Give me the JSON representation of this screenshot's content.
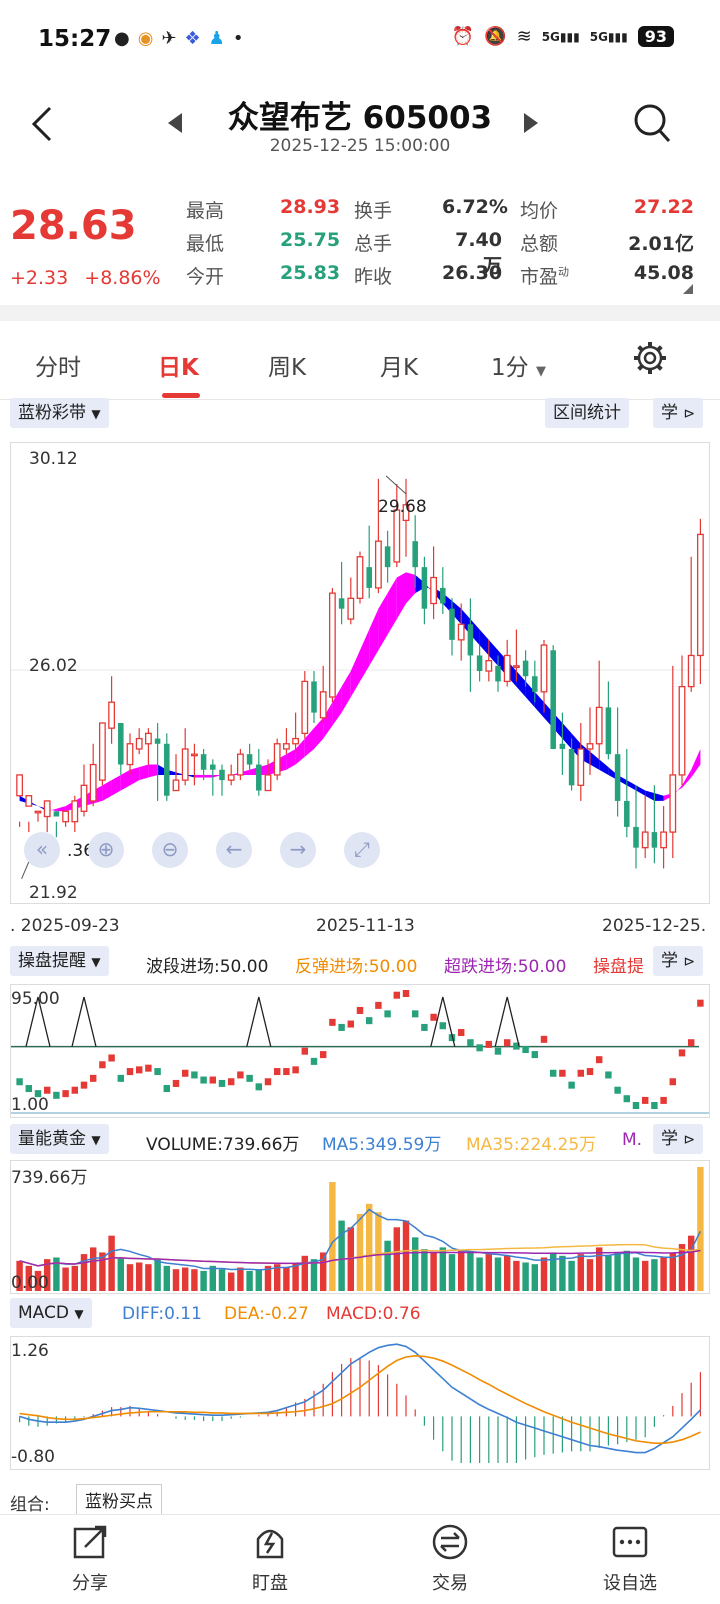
{
  "status_bar": {
    "time": "15:27",
    "battery": "93",
    "net1": "5G",
    "net2": "5G"
  },
  "header": {
    "title": "众望布艺 605003",
    "datetime": "2025-12-25 15:00:00"
  },
  "quote": {
    "price": "28.63",
    "change": "+2.33",
    "change_pct": "+8.86%",
    "rows": [
      [
        {
          "label": "最高",
          "value": "28.93",
          "color": "red"
        },
        {
          "label": "换手",
          "value": "6.72%",
          "color": "dark"
        },
        {
          "label": "均价",
          "value": "27.22",
          "color": "red"
        }
      ],
      [
        {
          "label": "最低",
          "value": "25.75",
          "color": "green"
        },
        {
          "label": "总手",
          "value": "7.40万",
          "color": "dark"
        },
        {
          "label": "总额",
          "value": "2.01亿",
          "color": "dark"
        }
      ],
      [
        {
          "label": "今开",
          "value": "25.83",
          "color": "green"
        },
        {
          "label": "昨收",
          "value": "26.30",
          "color": "dark"
        },
        {
          "label": "市盈",
          "value": "45.08",
          "color": "dark",
          "sup": "动"
        }
      ]
    ]
  },
  "tabs": [
    "分时",
    "日K",
    "周K",
    "月K",
    "1分",
    "设置"
  ],
  "active_tab": "日K",
  "main_chart": {
    "indicator": "蓝粉彩带",
    "stat_button": "区间统计",
    "learn": "学",
    "y_high": "30.12",
    "y_mid": "26.02",
    "y_low": "21.92",
    "max_label": "29.68",
    "min_label": ".36",
    "dates": [
      ". 2025-09-23",
      "2025-11-13",
      "2025-12-25."
    ]
  },
  "chart_data": {
    "type": "candlestick",
    "ylim": [
      21.92,
      30.12
    ],
    "x_start": "2025-09-23",
    "x_end": "2025-12-25",
    "candles": [
      [
        23.6,
        24.0,
        23.1,
        23.0
      ],
      [
        23.4,
        23.6,
        23.1,
        22.9
      ],
      [
        23.3,
        23.3,
        23.3,
        23.1
      ],
      [
        23.2,
        23.5,
        23.4,
        22.9
      ],
      [
        23.3,
        23.2,
        23.1,
        22.8
      ],
      [
        23.1,
        23.3,
        23.1,
        23.0
      ],
      [
        23.1,
        23.5,
        23.6,
        22.9
      ],
      [
        23.3,
        23.8,
        24.2,
        23.2
      ],
      [
        23.5,
        24.2,
        24.6,
        23.4
      ],
      [
        23.9,
        25.0,
        25.0,
        23.8
      ],
      [
        24.9,
        25.4,
        25.9,
        24.6
      ],
      [
        25.0,
        24.2,
        24.9,
        24.0
      ],
      [
        24.2,
        24.6,
        24.8,
        24.0
      ],
      [
        24.5,
        24.7,
        24.9,
        24.4
      ],
      [
        24.6,
        24.8,
        24.9,
        24.2
      ],
      [
        24.7,
        24.6,
        25.0,
        23.5
      ],
      [
        24.6,
        23.6,
        24.8,
        23.5
      ],
      [
        23.7,
        23.9,
        24.4,
        23.7
      ],
      [
        23.9,
        24.5,
        24.9,
        23.8
      ],
      [
        24.4,
        24.4,
        24.6,
        23.8
      ],
      [
        24.4,
        24.1,
        24.5,
        23.9
      ],
      [
        24.2,
        24.1,
        24.3,
        23.6
      ],
      [
        24.1,
        23.9,
        24.2,
        23.6
      ],
      [
        23.9,
        24.0,
        24.2,
        23.8
      ],
      [
        24.0,
        24.4,
        24.5,
        23.9
      ],
      [
        24.4,
        24.2,
        24.6,
        24.1
      ],
      [
        24.2,
        23.7,
        24.5,
        23.6
      ],
      [
        23.7,
        24.0,
        24.3,
        23.7
      ],
      [
        24.0,
        24.6,
        24.7,
        23.9
      ],
      [
        24.5,
        24.6,
        24.9,
        24.4
      ],
      [
        24.6,
        24.7,
        25.2,
        24.4
      ],
      [
        24.8,
        25.8,
        26.0,
        24.7
      ],
      [
        25.8,
        25.2,
        26.0,
        25.0
      ],
      [
        25.1,
        25.6,
        26.1,
        25.0
      ],
      [
        25.5,
        27.5,
        27.6,
        25.4
      ],
      [
        27.4,
        27.2,
        28.1,
        26.9
      ],
      [
        27.0,
        27.4,
        27.8,
        26.9
      ],
      [
        27.4,
        28.2,
        28.3,
        27.3
      ],
      [
        28.0,
        27.6,
        28.8,
        27.4
      ],
      [
        27.6,
        28.5,
        29.7,
        27.5
      ],
      [
        28.4,
        28.0,
        28.7,
        27.7
      ],
      [
        28.1,
        29.1,
        29.6,
        28.0
      ],
      [
        28.9,
        29.2,
        29.7,
        28.2
      ],
      [
        28.5,
        28.0,
        29.0,
        27.6
      ],
      [
        28.0,
        27.2,
        28.2,
        26.9
      ],
      [
        27.3,
        27.8,
        28.4,
        27.0
      ],
      [
        27.6,
        27.3,
        28.0,
        27.1
      ],
      [
        27.2,
        26.6,
        27.4,
        26.3
      ],
      [
        26.6,
        26.9,
        27.3,
        26.2
      ],
      [
        26.9,
        26.3,
        27.4,
        25.6
      ],
      [
        26.3,
        26.0,
        26.5,
        25.8
      ],
      [
        26.0,
        26.2,
        26.6,
        25.8
      ],
      [
        26.1,
        25.8,
        26.3,
        25.6
      ],
      [
        25.8,
        26.3,
        26.6,
        25.7
      ],
      [
        26.1,
        26.1,
        26.8,
        25.8
      ],
      [
        26.2,
        25.9,
        26.4,
        25.7
      ],
      [
        25.9,
        25.6,
        26.2,
        25.4
      ],
      [
        25.6,
        26.5,
        26.6,
        25.2
      ],
      [
        26.4,
        24.5,
        26.5,
        24.5
      ],
      [
        24.6,
        24.5,
        25.2,
        24.0
      ],
      [
        24.5,
        23.8,
        24.7,
        23.7
      ],
      [
        23.8,
        24.5,
        25.0,
        23.5
      ],
      [
        24.5,
        24.6,
        25.3,
        24.0
      ],
      [
        24.6,
        25.3,
        26.2,
        24.3
      ],
      [
        25.3,
        24.4,
        25.8,
        24.3
      ],
      [
        24.4,
        23.5,
        25.3,
        23.2
      ],
      [
        23.5,
        23.0,
        24.5,
        22.8
      ],
      [
        23.0,
        22.6,
        23.8,
        22.2
      ],
      [
        22.6,
        22.9,
        23.6,
        22.4
      ],
      [
        22.9,
        22.6,
        23.8,
        22.3
      ],
      [
        22.6,
        22.9,
        23.4,
        22.2
      ],
      [
        22.9,
        24.0,
        26.1,
        22.4
      ],
      [
        24.0,
        25.7,
        26.3,
        23.8
      ],
      [
        25.7,
        26.3,
        28.2,
        25.6
      ],
      [
        26.3,
        28.63,
        28.93,
        25.75
      ]
    ],
    "ribbon_upper": [
      23.6,
      23.5,
      23.4,
      23.3,
      23.35,
      23.4,
      23.5,
      23.6,
      23.7,
      23.8,
      23.9,
      24.0,
      24.1,
      24.15,
      24.2,
      24.2,
      24.1,
      24.05,
      24.0,
      23.95,
      23.95,
      23.95,
      24.0,
      24.0,
      24.05,
      24.1,
      24.15,
      24.2,
      24.3,
      24.4,
      24.5,
      24.7,
      24.9,
      25.1,
      25.4,
      25.7,
      26.0,
      26.4,
      26.8,
      27.2,
      27.5,
      27.8,
      27.9,
      27.85,
      27.7,
      27.5,
      27.3,
      27.1,
      26.9,
      26.7,
      26.5,
      26.3,
      26.1,
      25.9,
      25.7,
      25.5,
      25.3,
      25.1,
      24.9,
      24.7,
      24.5,
      24.3,
      24.2,
      24.1,
      24.0,
      23.9,
      23.8,
      23.7,
      23.6,
      23.5,
      23.5,
      23.6,
      23.8,
      24.1,
      24.5
    ],
    "ribbon_lower": [
      23.5,
      23.45,
      23.4,
      23.35,
      23.3,
      23.3,
      23.35,
      23.4,
      23.45,
      23.5,
      23.6,
      23.7,
      23.8,
      23.9,
      23.95,
      24.0,
      24.0,
      24.0,
      24.0,
      24.0,
      24.0,
      24.0,
      24.0,
      24.0,
      24.0,
      24.0,
      24.0,
      24.0,
      24.05,
      24.1,
      24.2,
      24.35,
      24.5,
      24.7,
      24.95,
      25.2,
      25.5,
      25.8,
      26.1,
      26.4,
      26.7,
      27.0,
      27.3,
      27.5,
      27.6,
      27.6,
      27.5,
      27.35,
      27.2,
      27.0,
      26.8,
      26.6,
      26.4,
      26.2,
      26.0,
      25.8,
      25.6,
      25.4,
      25.2,
      25.0,
      24.8,
      24.6,
      24.45,
      24.3,
      24.15,
      24.0,
      23.9,
      23.8,
      23.7,
      23.65,
      23.6,
      23.65,
      23.75,
      23.95,
      24.2
    ],
    "vol_label": "739.66万",
    "vol_volumes": [
      180,
      150,
      120,
      190,
      200,
      140,
      150,
      220,
      260,
      230,
      330,
      200,
      160,
      170,
      160,
      190,
      150,
      130,
      140,
      130,
      120,
      150,
      130,
      110,
      140,
      120,
      130,
      150,
      160,
      140,
      170,
      210,
      190,
      230,
      650,
      420,
      380,
      460,
      520,
      470,
      300,
      380,
      420,
      320,
      250,
      230,
      260,
      220,
      240,
      230,
      200,
      220,
      200,
      210,
      180,
      170,
      160,
      200,
      230,
      210,
      180,
      220,
      190,
      260,
      210,
      230,
      240,
      200,
      180,
      190,
      200,
      230,
      280,
      330,
      739.66
    ],
    "macd_ylim": [
      -0.8,
      1.26
    ],
    "macd_diff": [
      0.0,
      -0.05,
      -0.08,
      -0.1,
      -0.1,
      -0.1,
      -0.08,
      -0.05,
      0.0,
      0.05,
      0.1,
      0.12,
      0.15,
      0.14,
      0.12,
      0.1,
      0.08,
      0.06,
      0.05,
      0.04,
      0.03,
      0.02,
      0.02,
      0.03,
      0.04,
      0.05,
      0.06,
      0.07,
      0.1,
      0.15,
      0.2,
      0.25,
      0.35,
      0.45,
      0.6,
      0.75,
      0.9,
      1.0,
      1.1,
      1.18,
      1.22,
      1.24,
      1.2,
      1.1,
      0.95,
      0.8,
      0.65,
      0.5,
      0.4,
      0.3,
      0.2,
      0.12,
      0.05,
      -0.02,
      -0.1,
      -0.15,
      -0.2,
      -0.25,
      -0.3,
      -0.35,
      -0.4,
      -0.45,
      -0.5,
      -0.52,
      -0.55,
      -0.58,
      -0.6,
      -0.62,
      -0.62,
      -0.55,
      -0.45,
      -0.35,
      -0.2,
      -0.05,
      0.11
    ],
    "macd_dea": [
      0.05,
      0.03,
      0.01,
      -0.02,
      -0.04,
      -0.05,
      -0.05,
      -0.04,
      -0.02,
      0.0,
      0.02,
      0.04,
      0.06,
      0.07,
      0.08,
      0.08,
      0.08,
      0.08,
      0.08,
      0.07,
      0.07,
      0.06,
      0.06,
      0.05,
      0.05,
      0.05,
      0.05,
      0.05,
      0.06,
      0.07,
      0.08,
      0.1,
      0.13,
      0.17,
      0.22,
      0.3,
      0.4,
      0.5,
      0.62,
      0.74,
      0.86,
      0.96,
      1.02,
      1.04,
      1.03,
      1.0,
      0.95,
      0.88,
      0.8,
      0.72,
      0.63,
      0.55,
      0.46,
      0.38,
      0.3,
      0.22,
      0.15,
      0.08,
      0.02,
      -0.04,
      -0.1,
      -0.15,
      -0.2,
      -0.25,
      -0.3,
      -0.34,
      -0.38,
      -0.42,
      -0.44,
      -0.46,
      -0.46,
      -0.44,
      -0.4,
      -0.34,
      -0.27
    ]
  },
  "sub1": {
    "name": "操盘提醒",
    "items": [
      {
        "text": "波段进场:50.00",
        "color": "#222222"
      },
      {
        "text": "反弹进场:50.00",
        "color": "#f08c00"
      },
      {
        "text": "超跌进场:50.00",
        "color": "#9c27b0"
      },
      {
        "text": "操盘提",
        "color": "#e53935"
      }
    ],
    "y_high": "95.00",
    "y_low": "1.00"
  },
  "sub2": {
    "name": "量能黄金",
    "items": [
      {
        "text": "VOLUME:739.66万",
        "color": "#222222"
      },
      {
        "text": "MA5:349.59万",
        "color": "#3d7fd1"
      },
      {
        "text": "MA35:224.25万",
        "color": "#f5b842"
      },
      {
        "text": "M.",
        "color": "#9c27b0"
      }
    ],
    "y_high": "739.66万",
    "y_low": "0.00"
  },
  "sub3": {
    "name": "MACD",
    "items": [
      {
        "text": "DIFF:0.11",
        "color": "#3d7fd1"
      },
      {
        "text": "DEA:-0.27",
        "color": "#f08c00"
      },
      {
        "text": "MACD:0.76",
        "color": "#e53935"
      }
    ],
    "y_high": "1.26",
    "y_low": "-0.80"
  },
  "combo": {
    "label": "组合:",
    "value": "蓝粉买点"
  },
  "bottom_nav": [
    {
      "label": "分享",
      "icon": "share-icon"
    },
    {
      "label": "盯盘",
      "icon": "watch-icon"
    },
    {
      "label": "交易",
      "icon": "trade-icon"
    },
    {
      "label": "设自选",
      "icon": "favorite-icon"
    }
  ],
  "colors": {
    "up": "#e53935",
    "down": "#26a17b",
    "ribbon_up": "#ff00ff",
    "ribbon_down": "#0000ee",
    "chip_bg": "#e6ebf7"
  }
}
